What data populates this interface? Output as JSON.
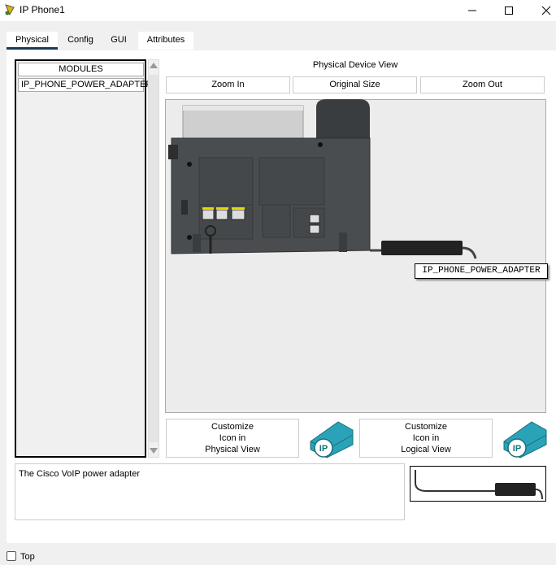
{
  "window": {
    "title": "IP Phone1",
    "minimize_icon": "minimize-icon",
    "maximize_icon": "maximize-icon",
    "close_icon": "close-icon"
  },
  "tabs": [
    {
      "label": "Physical",
      "active": true
    },
    {
      "label": "Config",
      "active": false
    },
    {
      "label": "GUI",
      "active": false
    },
    {
      "label": "Attributes",
      "active": false
    }
  ],
  "modules": {
    "header": "MODULES",
    "items": [
      "IP_PHONE_POWER_ADAPTER"
    ]
  },
  "physical_view": {
    "title": "Physical Device View",
    "zoom_in": "Zoom In",
    "original_size": "Original Size",
    "zoom_out": "Zoom Out",
    "port_label": "IP_PHONE_POWER_ADAPTER"
  },
  "customize": {
    "physical": "Customize\nIcon in\nPhysical View",
    "logical": "Customize\nIcon in\nLogical View"
  },
  "description": "The Cisco VoIP power adapter",
  "footer": {
    "top_label": "Top",
    "top_checked": false
  },
  "colors": {
    "tab_active": "#1a3a5c",
    "ip_icon": "#2aa3b8"
  }
}
